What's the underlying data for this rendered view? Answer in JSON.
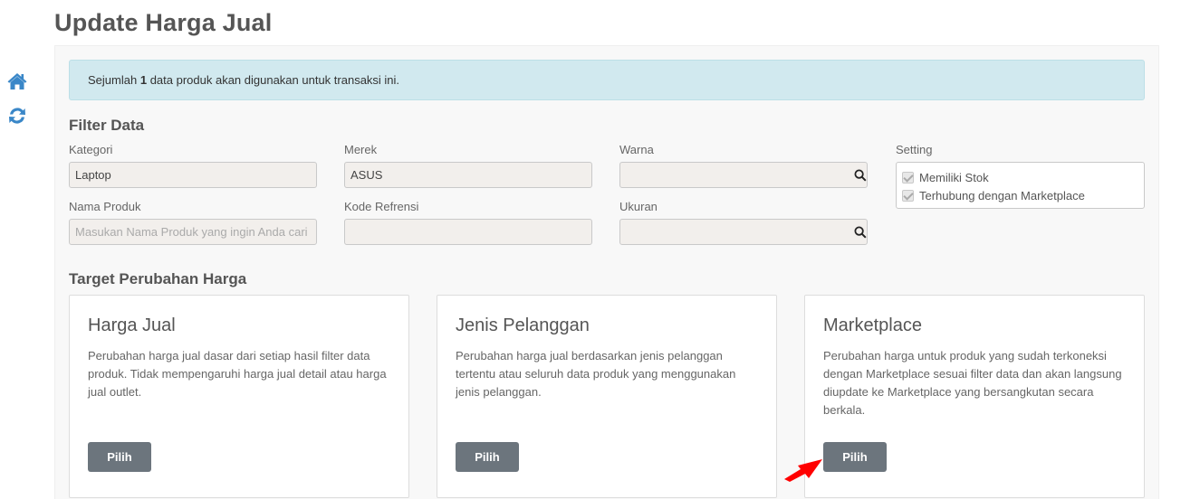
{
  "page": {
    "title": "Update Harga Jual"
  },
  "sidebar": {
    "icons": [
      "home-icon",
      "refresh-icon"
    ],
    "icon_color": "#3a87c8"
  },
  "alert": {
    "prefix": "Sejumlah",
    "count": "1",
    "suffix": "data produk akan digunakan untuk transaksi ini."
  },
  "filter": {
    "title": "Filter Data",
    "kategori": {
      "label": "Kategori",
      "value": "Laptop"
    },
    "merek": {
      "label": "Merek",
      "value": "ASUS"
    },
    "warna": {
      "label": "Warna",
      "value": ""
    },
    "setting": {
      "label": "Setting",
      "options": [
        {
          "label": "Memiliki Stok",
          "checked": true
        },
        {
          "label": "Terhubung dengan Marketplace",
          "checked": true
        }
      ]
    },
    "nama_produk": {
      "label": "Nama Produk",
      "value": "",
      "placeholder": "Masukan Nama Produk yang ingin Anda cari"
    },
    "kode_refrensi": {
      "label": "Kode Refrensi",
      "value": ""
    },
    "ukuran": {
      "label": "Ukuran",
      "value": ""
    }
  },
  "target": {
    "title": "Target Perubahan Harga",
    "cards": [
      {
        "title": "Harga Jual",
        "desc": "Perubahan harga jual dasar dari setiap hasil filter data produk. Tidak mempengaruhi harga jual detail atau harga jual outlet.",
        "button": "Pilih"
      },
      {
        "title": "Jenis Pelanggan",
        "desc": "Perubahan harga jual berdasarkan jenis pelanggan tertentu atau seluruh data produk yang menggunakan jenis pelanggan.",
        "button": "Pilih"
      },
      {
        "title": "Marketplace",
        "desc": "Perubahan harga untuk produk yang sudah terkoneksi dengan Marketplace sesuai filter data dan akan langsung diupdate ke Marketplace yang bersangkutan secara berkala.",
        "button": "Pilih"
      }
    ]
  },
  "colors": {
    "alert_bg": "#d1e9ef",
    "button_bg": "#6c757d",
    "annotation_arrow": "#ff0000"
  }
}
